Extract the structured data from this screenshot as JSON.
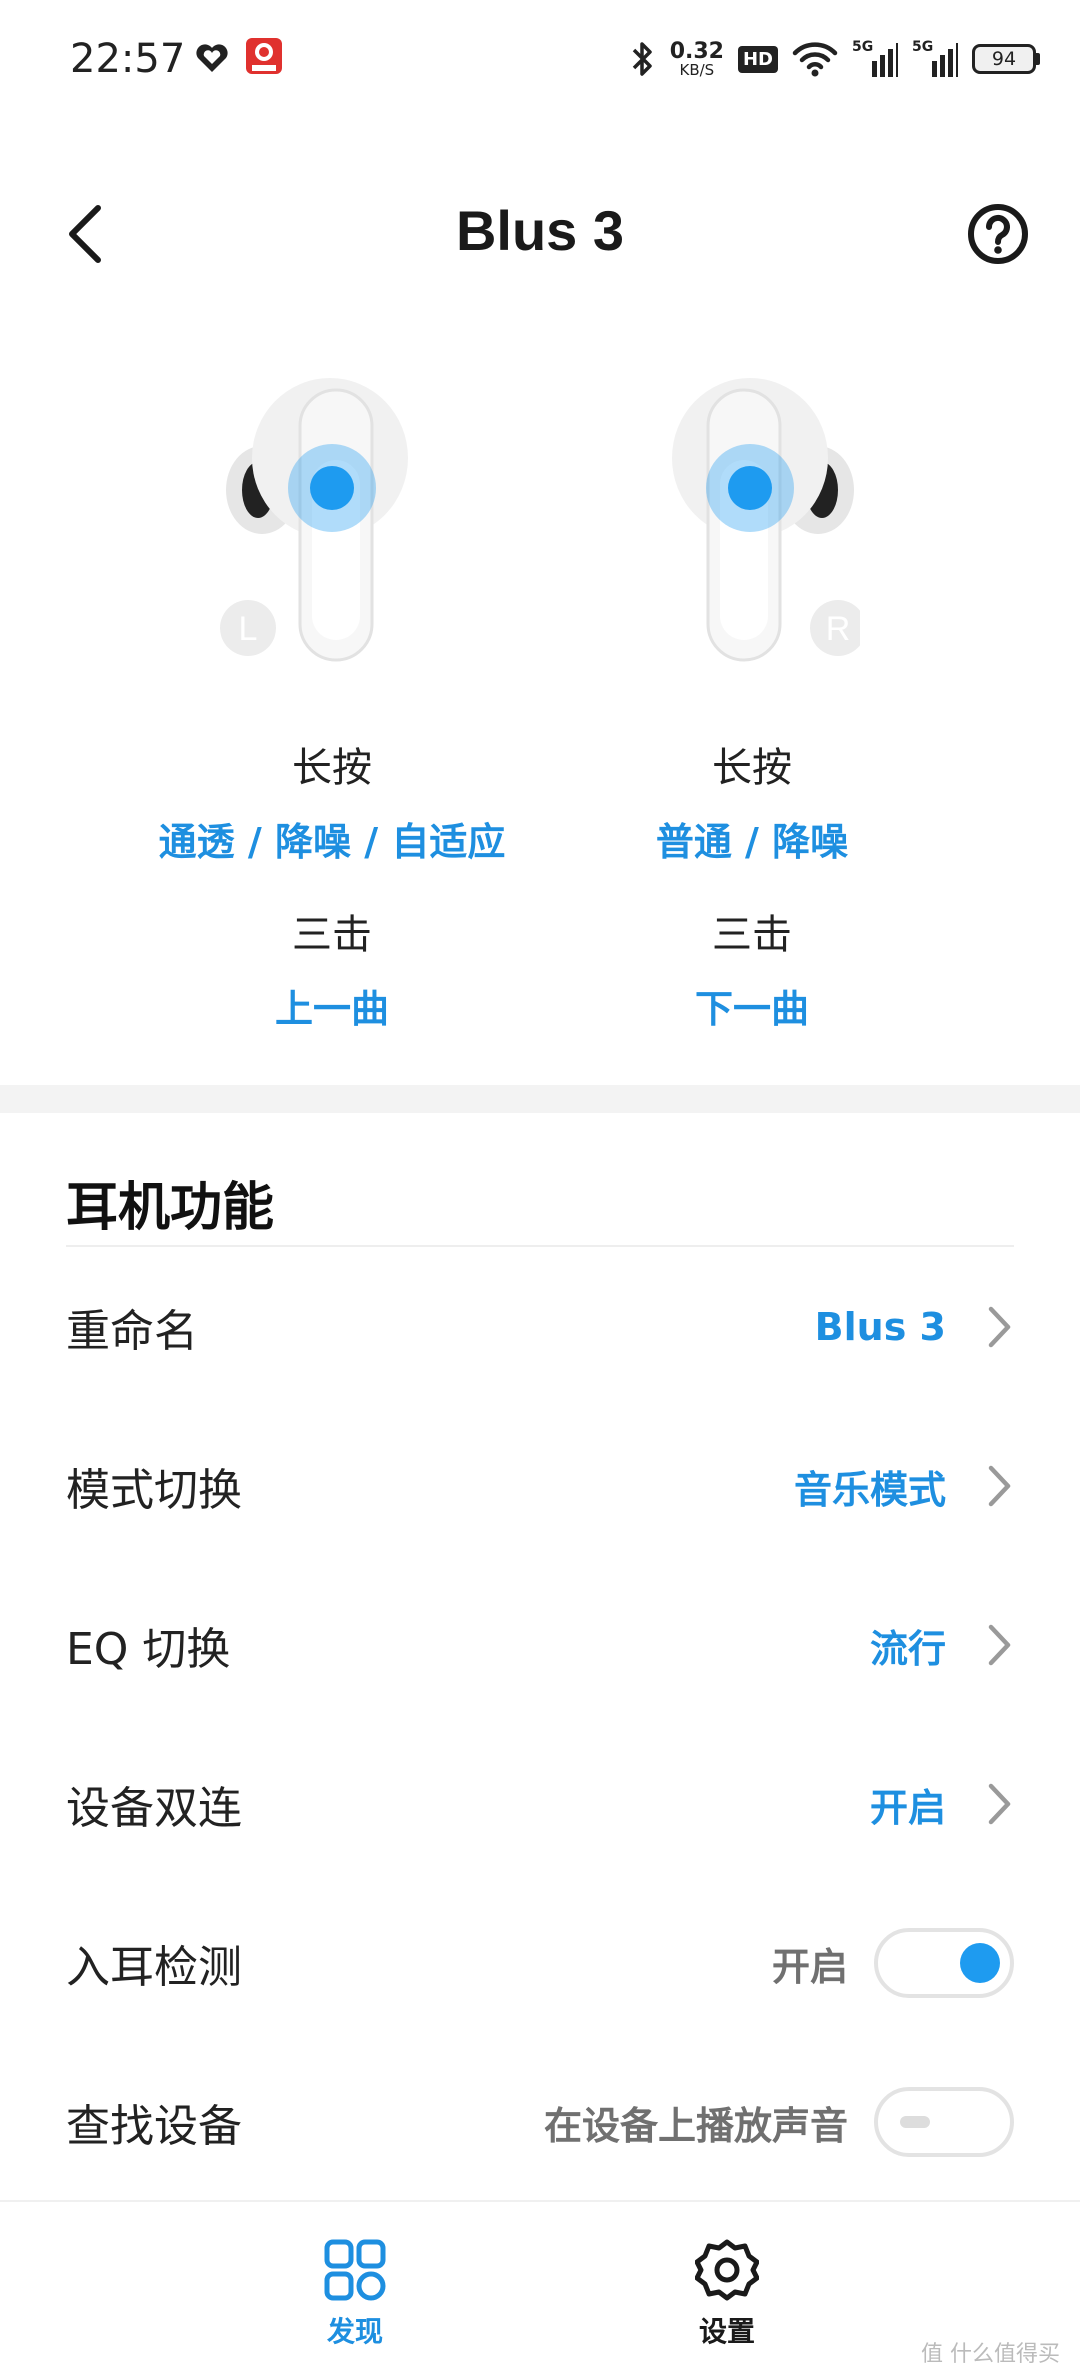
{
  "status_bar": {
    "time": "22:57",
    "net_speed_value": "0.32",
    "net_speed_unit": "KB/S",
    "hd_label": "HD",
    "sim1_label": "5G",
    "sim2_label": "5G",
    "battery": "94",
    "icons": [
      "heart-icon",
      "event-badge-icon",
      "bluetooth-icon",
      "wifi-icon",
      "signal-icon",
      "battery-icon"
    ]
  },
  "header": {
    "title": "Blus 3"
  },
  "earbuds": {
    "left_marker": "L",
    "right_marker": "R",
    "left": {
      "long_press_label": "长按",
      "long_press_value": "通透 / 降噪 / 自适应",
      "triple_tap_label": "三击",
      "triple_tap_value": "上一曲"
    },
    "right": {
      "long_press_label": "长按",
      "long_press_value": "普通 / 降噪",
      "triple_tap_label": "三击",
      "triple_tap_value": "下一曲"
    }
  },
  "section": {
    "title": "耳机功能",
    "rows": [
      {
        "name": "重命名",
        "value": "Blus 3"
      },
      {
        "name": "模式切换",
        "value": "音乐模式"
      },
      {
        "name": "EQ 切换",
        "value": "流行"
      },
      {
        "name": "设备双连",
        "value": "开启"
      },
      {
        "name": "入耳检测",
        "value": "开启",
        "toggle": true
      },
      {
        "name": "查找设备",
        "value": "在设备上播放声音",
        "toggle": false
      }
    ]
  },
  "bottom_nav": {
    "discover": "发现",
    "settings": "设置"
  },
  "watermark": "值 什么值得买",
  "colors": {
    "accent": "#1e8fe0",
    "toggle_on": "#1e9bf0",
    "band": "#f3f3f3"
  }
}
